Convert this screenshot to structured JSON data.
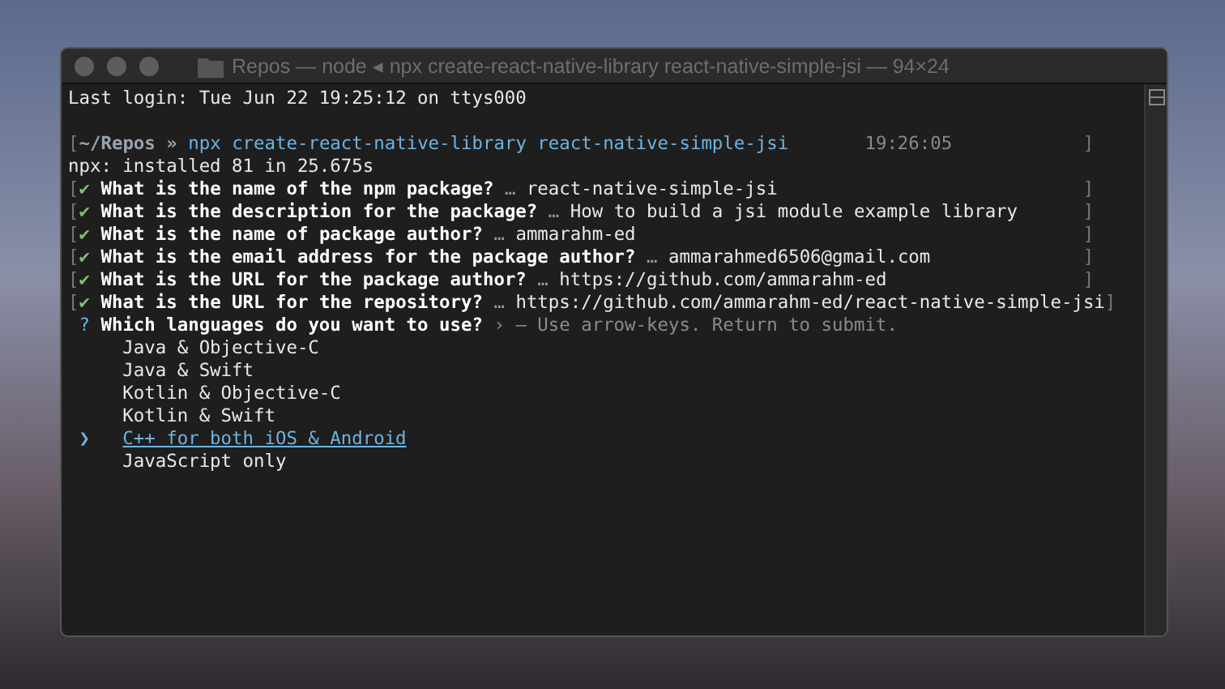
{
  "window": {
    "title": "Repos — node ◂ npx create-react-native-library react-native-simple-jsi — 94×24"
  },
  "lines": [
    {
      "kind": "text",
      "text": "Last login: Tue Jun 22 19:25:12 on ttys000"
    },
    {
      "kind": "blank"
    },
    {
      "kind": "prompt",
      "left_bracket": "[",
      "cwd": "~/Repos",
      "arrow": "»",
      "command": "npx create-react-native-library react-native-simple-jsi",
      "time": "19:26:05",
      "right_bracket": "]"
    },
    {
      "kind": "text",
      "text": "npx: installed 81 in 25.675s"
    },
    {
      "kind": "answered",
      "left_bracket": "[",
      "check": "✔",
      "question": "What is the name of the npm package?",
      "ellipsis": "…",
      "answer": "react-native-simple-jsi",
      "right_bracket": "]"
    },
    {
      "kind": "answered",
      "left_bracket": "[",
      "check": "✔",
      "question": "What is the description for the package?",
      "ellipsis": "…",
      "answer": "How to build a jsi module example library",
      "right_bracket": "]"
    },
    {
      "kind": "answered",
      "left_bracket": "[",
      "check": "✔",
      "question": "What is the name of package author?",
      "ellipsis": "…",
      "answer": "ammarahm-ed",
      "right_bracket": "]"
    },
    {
      "kind": "answered",
      "left_bracket": "[",
      "check": "✔",
      "question": "What is the email address for the package author?",
      "ellipsis": "…",
      "answer": "ammarahmed6506@gmail.com",
      "right_bracket": "]"
    },
    {
      "kind": "answered",
      "left_bracket": "[",
      "check": "✔",
      "question": "What is the URL for the package author?",
      "ellipsis": "…",
      "answer": "https://github.com/ammarahm-ed",
      "right_bracket": "]"
    },
    {
      "kind": "answered",
      "left_bracket": "[",
      "check": "✔",
      "question": "What is the URL for the repository?",
      "ellipsis": "…",
      "answer": "https://github.com/ammarahm-ed/react-native-simple-jsi",
      "right_bracket": "]"
    },
    {
      "kind": "question",
      "mark": "?",
      "question": "Which languages do you want to use?",
      "pointer": "›",
      "hint": "– Use arrow-keys. Return to submit.",
      "cursor": "❯",
      "options": [
        {
          "label": "Java & Objective-C",
          "selected": false
        },
        {
          "label": "Java & Swift",
          "selected": false
        },
        {
          "label": "Kotlin & Objective-C",
          "selected": false
        },
        {
          "label": "Kotlin & Swift",
          "selected": false
        },
        {
          "label": "C++ for both iOS & Android",
          "selected": true
        },
        {
          "label": "JavaScript only",
          "selected": false
        }
      ]
    }
  ]
}
